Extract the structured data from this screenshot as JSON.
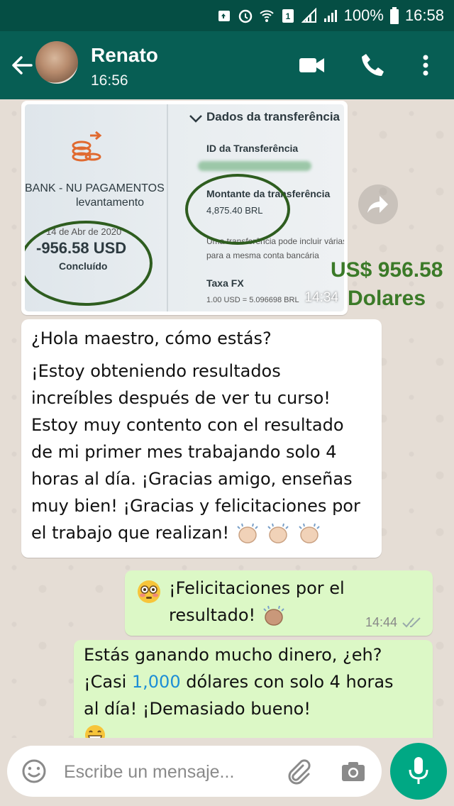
{
  "status_bar": {
    "battery": "100%",
    "time": "16:58"
  },
  "header": {
    "contact_name": "Renato",
    "subtitle": "16:56"
  },
  "image_message": {
    "time": "14:34",
    "photo_text": {
      "section_title": "Dados da transferência",
      "id_label": "ID da Transferência",
      "bank_line1": "BANK - NU PAGAMENTOS",
      "bank_line2": "levantamento",
      "amount_label": "Montante da transferência",
      "amount_value": "4,875.40 BRL",
      "date": "14 de Abr de 2020",
      "usd_amount": "-956.58 USD",
      "status": "Concluído",
      "note_line1": "Uma transferência pode incluir várias",
      "note_line2": "para a mesma conta bancária",
      "fx_label": "Taxa FX",
      "fx_value": "1.00 USD = 5.096698 BRL"
    }
  },
  "overlay": {
    "line1": "US$ 956.58",
    "line2": "Dolares"
  },
  "messages": [
    {
      "type": "incoming",
      "lines": [
        "¿Hola maestro, cómo estás?",
        "¡Estoy obteniendo resultados",
        "increíbles después de ver tu curso!",
        "Estoy muy contento con el resultado",
        "de mi primer mes trabajando solo 4",
        "horas al día. ¡Gracias amigo, enseñas",
        "muy bien! ¡Gracias y felicitaciones por",
        "el trabajo que realizan!"
      ]
    },
    {
      "type": "outgoing",
      "lines": [
        "¡Felicitaciones por el",
        "resultado!"
      ],
      "time": "14:44"
    },
    {
      "type": "outgoing",
      "line1": "Estás ganando mucho dinero, ¿eh?",
      "line2_pre": "¡Casi ",
      "line2_highlight": "1,000",
      "line2_post": " dólares con solo 4 horas",
      "line3": "al día! ¡Demasiado bueno!"
    }
  ],
  "composer": {
    "placeholder": "Escribe un mensaje..."
  },
  "colors": {
    "header": "#075e54",
    "status_bar": "#054e44",
    "outgoing_bubble": "#dcf8c6",
    "mic_button": "#00a884",
    "overlay_text": "#3b7a28",
    "link_highlight": "#1d8ed6"
  },
  "icons": [
    "back-arrow-icon",
    "video-call-icon",
    "phone-icon",
    "more-options-icon",
    "forward-icon",
    "emoji-icon",
    "attach-icon",
    "camera-icon",
    "mic-icon",
    "double-check-icon"
  ]
}
